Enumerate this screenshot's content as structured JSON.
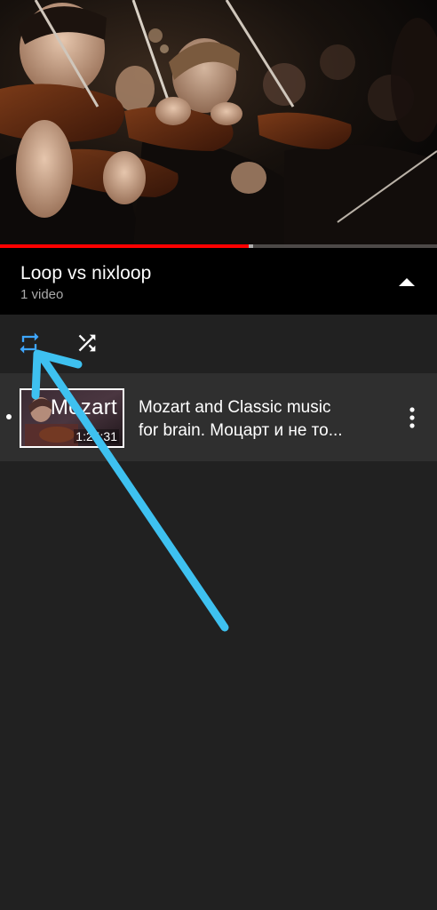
{
  "player": {
    "progress_fraction": 0.57,
    "buffered_fraction": 0.58,
    "progress_color": "#ff0000"
  },
  "playlist": {
    "title": "Loop vs nixloop",
    "count": "1 video",
    "collapse_icon": "chevron-up-icon"
  },
  "controls": {
    "loop_icon": "loop-icon",
    "loop_active_color": "#3ea6ff",
    "shuffle_icon": "shuffle-icon"
  },
  "items": [
    {
      "thumbnail_text": "Mozart",
      "duration": "1:25:31",
      "title_line1": "Mozart and Classic music",
      "title_line2": "for brain. Моцарт и не то...",
      "more_icon": "more-vertical-icon"
    }
  ],
  "annotation": {
    "arrow_color": "#3ec1f0"
  }
}
